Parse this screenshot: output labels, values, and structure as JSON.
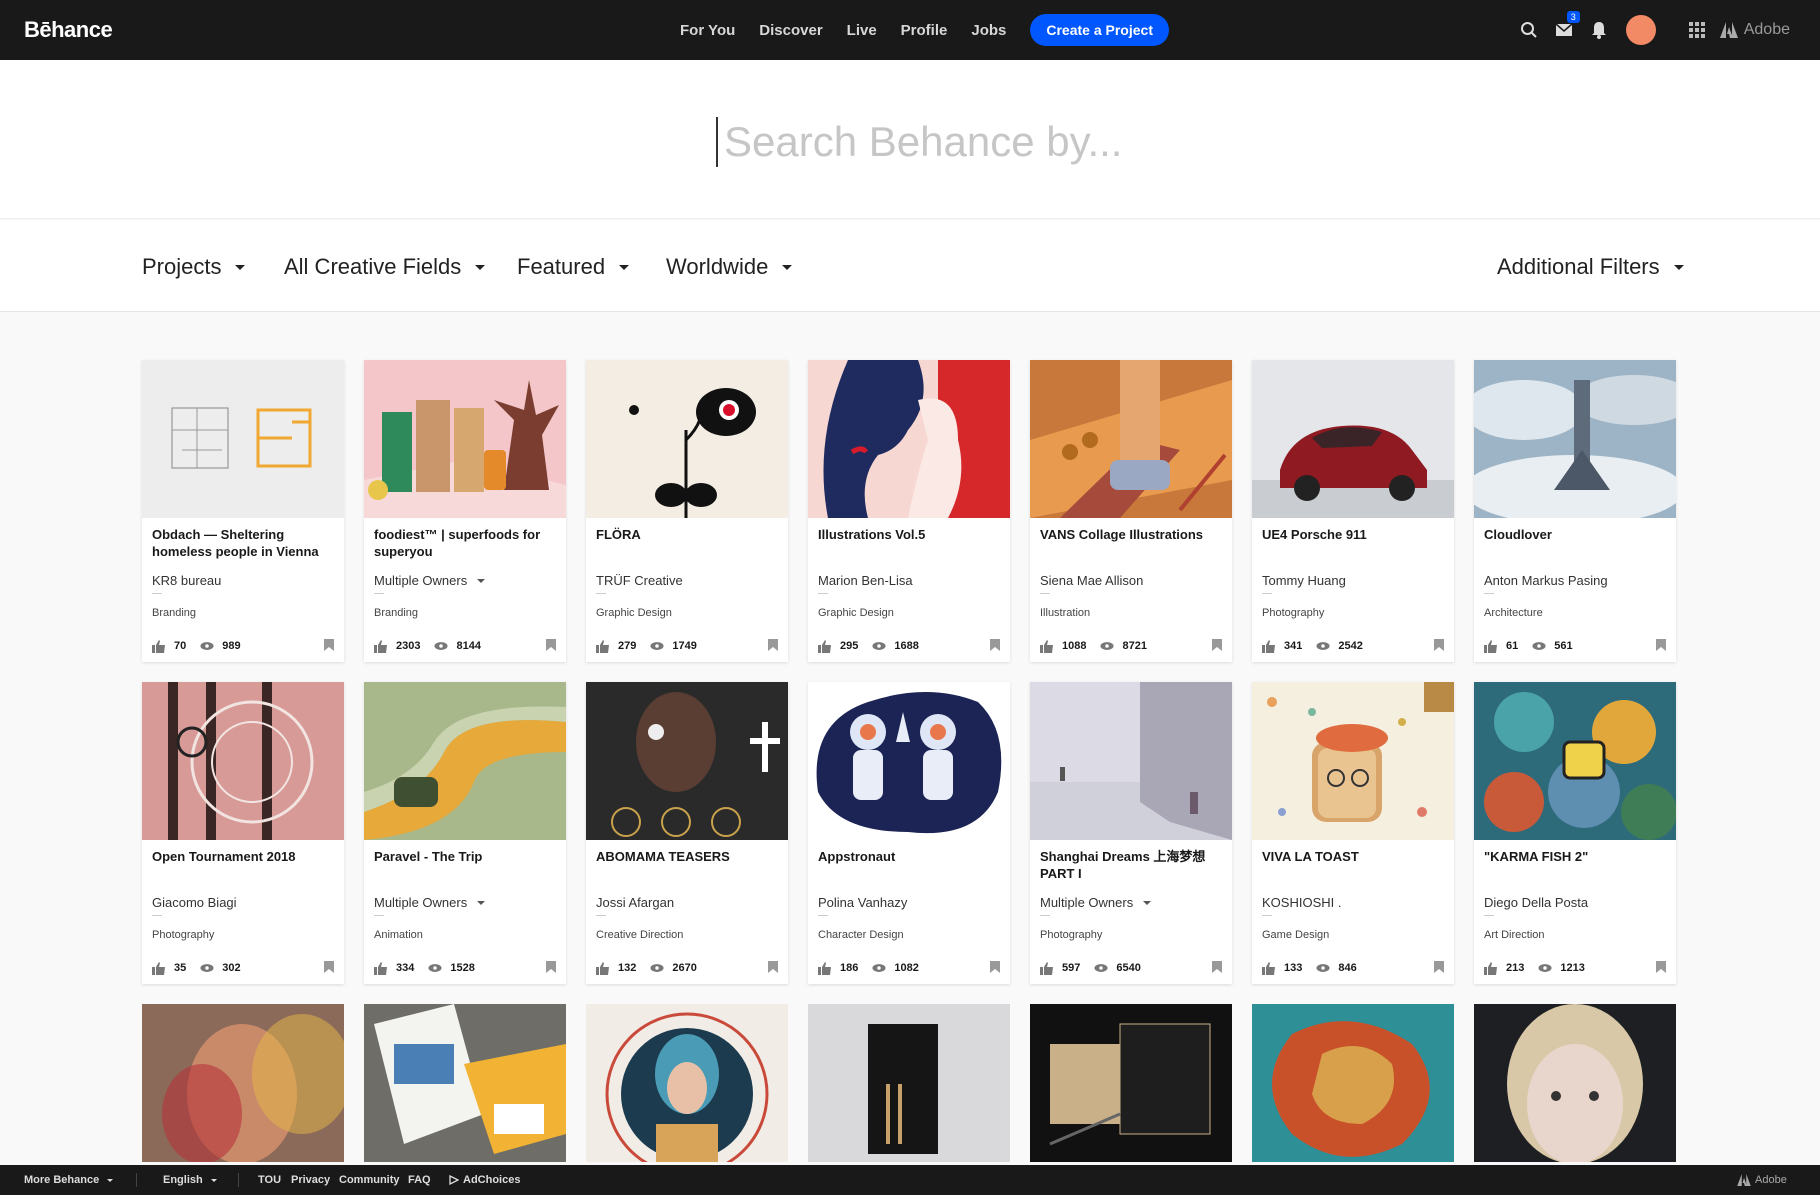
{
  "header": {
    "logo": "Bēhance",
    "nav": [
      "For You",
      "Discover",
      "Live",
      "Profile",
      "Jobs"
    ],
    "create_label": "Create a Project",
    "messages_badge": "3",
    "adobe_label": "Adobe"
  },
  "search": {
    "placeholder": "Search Behance by..."
  },
  "filters": {
    "type": "Projects",
    "fields": "All Creative Fields",
    "sort": "Featured",
    "region": "Worldwide",
    "additional": "Additional Filters"
  },
  "projects": [
    {
      "title": "Obdach — Sheltering homeless people in Vienna",
      "owner": "KR8 bureau",
      "field": "Branding",
      "likes": "70",
      "views": "989"
    },
    {
      "title": "foodiest™ | superfoods for superyou",
      "owner": "Multiple Owners",
      "field": "Branding",
      "likes": "2303",
      "views": "8144"
    },
    {
      "title": "FLÖRA",
      "owner": "TRÜF Creative",
      "field": "Graphic Design",
      "likes": "279",
      "views": "1749"
    },
    {
      "title": "Illustrations Vol.5",
      "owner": "Marion Ben-Lisa",
      "field": "Graphic Design",
      "likes": "295",
      "views": "1688"
    },
    {
      "title": "VANS Collage Illustrations",
      "owner": "Siena Mae Allison",
      "field": "Illustration",
      "likes": "1088",
      "views": "8721"
    },
    {
      "title": "UE4 Porsche 911",
      "owner": "Tommy Huang",
      "field": "Photography",
      "likes": "341",
      "views": "2542"
    },
    {
      "title": "Cloudlover",
      "owner": "Anton Markus Pasing",
      "field": "Architecture",
      "likes": "61",
      "views": "561"
    },
    {
      "title": "Open Tournament 2018",
      "owner": "Giacomo Biagi",
      "field": "Photography",
      "likes": "35",
      "views": "302"
    },
    {
      "title": "Paravel - The Trip",
      "owner": "Multiple Owners",
      "field": "Animation",
      "likes": "334",
      "views": "1528"
    },
    {
      "title": "ABOMAMA TEASERS",
      "owner": "Jossi Afargan",
      "field": "Creative Direction",
      "likes": "132",
      "views": "2670"
    },
    {
      "title": "Appstronaut",
      "owner": "Polina Vanhazy",
      "field": "Character Design",
      "likes": "186",
      "views": "1082"
    },
    {
      "title": "Shanghai Dreams 上海梦想 PART I",
      "owner": "Multiple Owners",
      "field": "Photography",
      "likes": "597",
      "views": "6540"
    },
    {
      "title": "VIVA LA TOAST",
      "owner": "KOSHIOSHI .",
      "field": "Game Design",
      "likes": "133",
      "views": "846"
    },
    {
      "title": "\"KARMA FISH 2\"",
      "owner": "Diego Della Posta",
      "field": "Art Direction",
      "likes": "213",
      "views": "1213"
    }
  ],
  "footer": {
    "more": "More Behance",
    "language": "English",
    "links": [
      "TOU",
      "Privacy",
      "Community",
      "FAQ"
    ],
    "adchoices": "AdChoices",
    "adobe": "Adobe"
  }
}
